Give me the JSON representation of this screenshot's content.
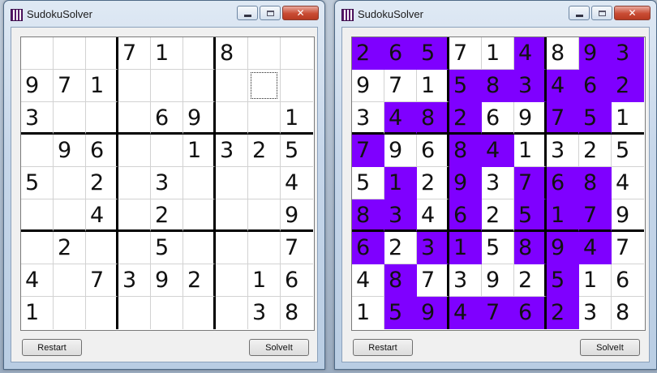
{
  "windows": [
    {
      "title": "SudokuSolver",
      "buttons": {
        "restart": "Restart",
        "solve": "SolveIt"
      },
      "grid": [
        [
          "",
          "",
          "",
          "7",
          "1",
          "",
          "8",
          "",
          ""
        ],
        [
          "9",
          "7",
          "1",
          "",
          "",
          "",
          "",
          "",
          ""
        ],
        [
          "3",
          "",
          "",
          "",
          "6",
          "9",
          "",
          "",
          "1"
        ],
        [
          "",
          "9",
          "6",
          "",
          "",
          "1",
          "3",
          "2",
          "5"
        ],
        [
          "5",
          "",
          "2",
          "",
          "3",
          "",
          "",
          "",
          "4"
        ],
        [
          "",
          "",
          "4",
          "",
          "2",
          "",
          "",
          "",
          "9"
        ],
        [
          "",
          "2",
          "",
          "",
          "5",
          "",
          "",
          "",
          "7"
        ],
        [
          "4",
          "",
          "7",
          "3",
          "9",
          "2",
          "",
          "1",
          "6"
        ],
        [
          "1",
          "",
          "",
          "",
          "",
          "",
          "",
          "3",
          "8"
        ]
      ],
      "focused_cell": [
        1,
        7
      ]
    },
    {
      "title": "SudokuSolver",
      "buttons": {
        "restart": "Restart",
        "solve": "SolveIt"
      },
      "grid": [
        [
          "2",
          "6",
          "5",
          "7",
          "1",
          "4",
          "8",
          "9",
          "3"
        ],
        [
          "9",
          "7",
          "1",
          "5",
          "8",
          "3",
          "4",
          "6",
          "2"
        ],
        [
          "3",
          "4",
          "8",
          "2",
          "6",
          "9",
          "7",
          "5",
          "1"
        ],
        [
          "7",
          "9",
          "6",
          "8",
          "4",
          "1",
          "3",
          "2",
          "5"
        ],
        [
          "5",
          "1",
          "2",
          "9",
          "3",
          "7",
          "6",
          "8",
          "4"
        ],
        [
          "8",
          "3",
          "4",
          "6",
          "2",
          "5",
          "1",
          "7",
          "9"
        ],
        [
          "6",
          "2",
          "3",
          "1",
          "5",
          "8",
          "9",
          "4",
          "7"
        ],
        [
          "4",
          "8",
          "7",
          "3",
          "9",
          "2",
          "5",
          "1",
          "6"
        ],
        [
          "1",
          "5",
          "9",
          "4",
          "7",
          "6",
          "2",
          "3",
          "8"
        ]
      ],
      "solved_cells_highlighted": true
    }
  ],
  "colors": {
    "solved_highlight": "#7f00ff",
    "box_border": "#000000"
  }
}
